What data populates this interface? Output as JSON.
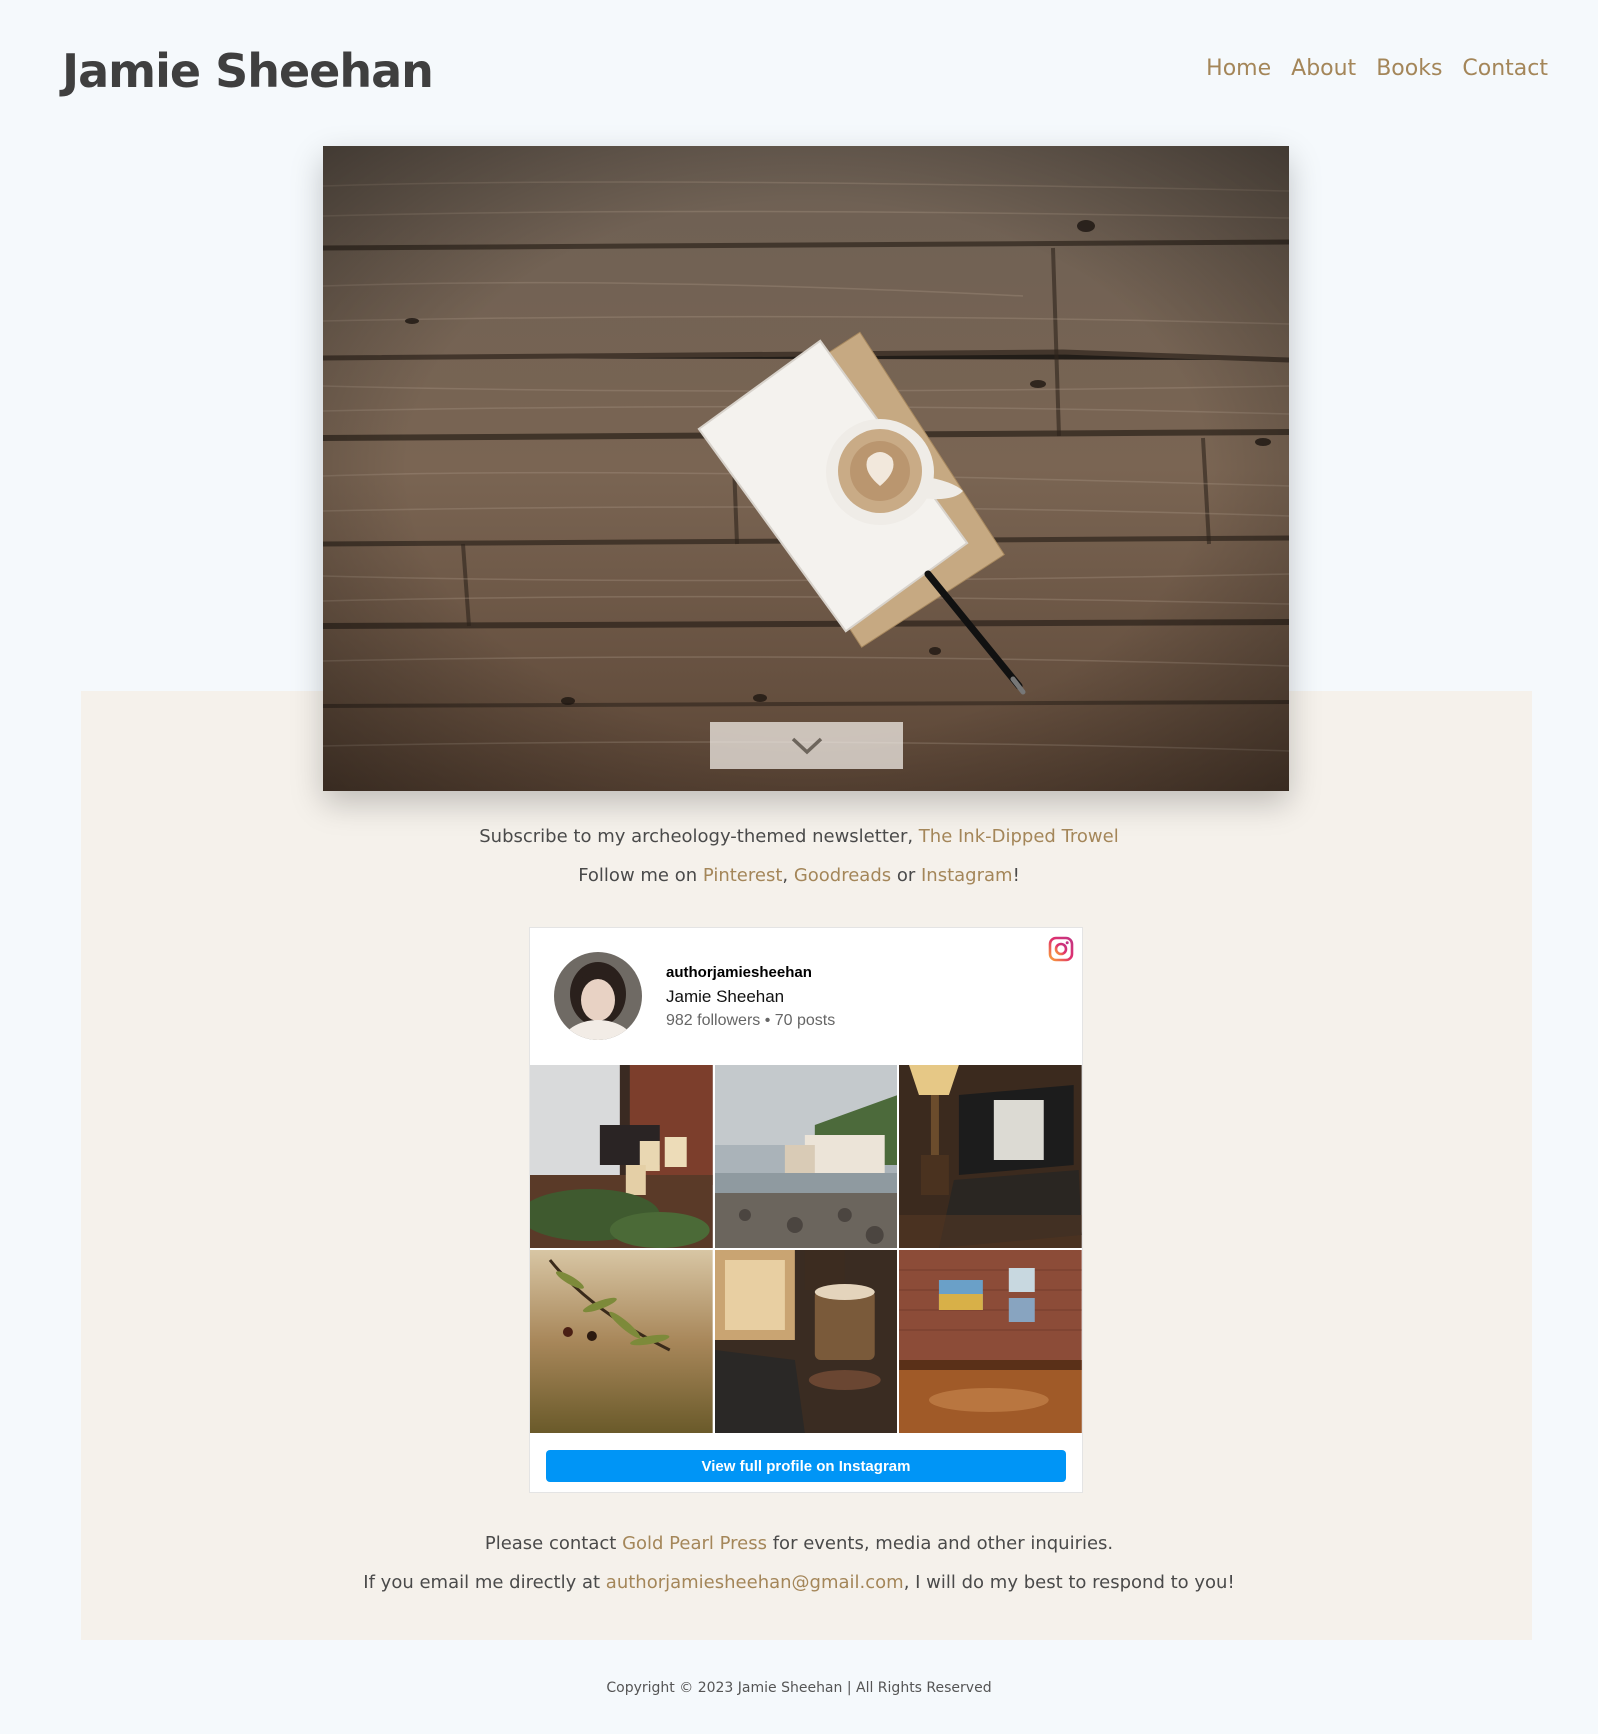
{
  "site": {
    "title": "Jamie Sheehan"
  },
  "nav": [
    {
      "label": "Home"
    },
    {
      "label": "About"
    },
    {
      "label": "Books"
    },
    {
      "label": "Contact"
    }
  ],
  "newsletter": {
    "prefix": "Subscribe to my archeology-themed newsletter, ",
    "link": "The Ink-Dipped Trowel"
  },
  "follow": {
    "prefix": "Follow me on ",
    "pinterest": "Pinterest",
    "comma": ", ",
    "goodreads": "Goodreads",
    "or": " or ",
    "instagram": "Instagram",
    "suffix": "!"
  },
  "instagram_widget": {
    "handle": "authorjamiesheehan",
    "name": "Jamie Sheehan",
    "stats": "982 followers • 70 posts",
    "button_label": "View full profile on Instagram",
    "button_color": "#0095f6"
  },
  "contact": {
    "prefix": "Please contact ",
    "press_link": "Gold Pearl Press",
    "suffix": " for events, media and other inquiries."
  },
  "email": {
    "prefix": "If you email me directly at ",
    "address": "authorjamiesheehan@gmail.com",
    "suffix": ", I will do my best to respond to you!"
  },
  "footer": {
    "copyright": "Copyright © 2023 Jamie Sheehan | All Rights Reserved"
  },
  "colors": {
    "accent": "#a48659",
    "background": "#f5f9fc",
    "band": "#f5f1eb"
  }
}
